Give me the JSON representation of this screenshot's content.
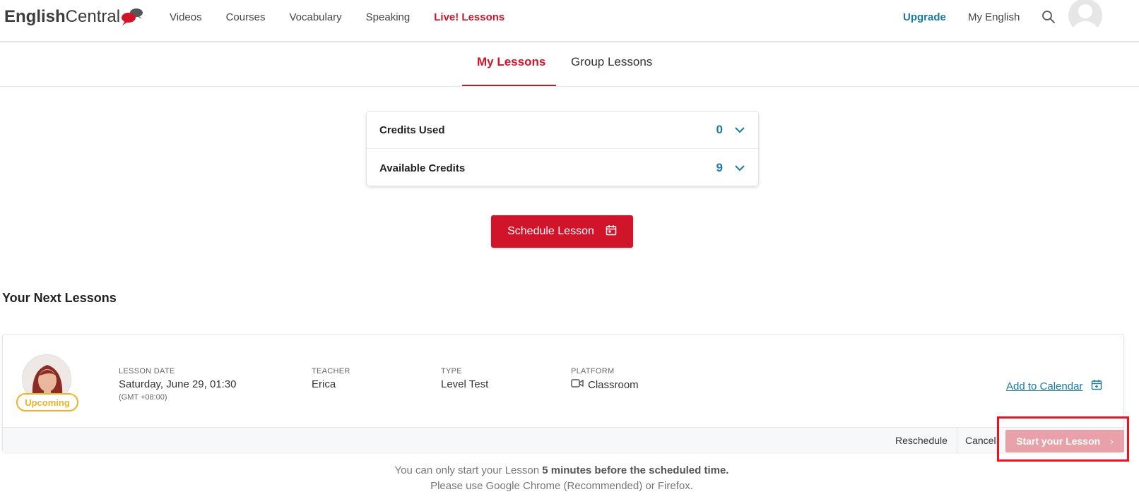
{
  "brand": {
    "english": "English",
    "central": "Central",
    "bubble_colors": [
      "#d0142a",
      "#555555"
    ]
  },
  "nav": {
    "items": [
      {
        "label": "Videos",
        "active": false
      },
      {
        "label": "Courses",
        "active": false
      },
      {
        "label": "Vocabulary",
        "active": false
      },
      {
        "label": "Speaking",
        "active": false
      },
      {
        "label": "Live! Lessons",
        "active": true
      }
    ],
    "upgrade": "Upgrade",
    "my_english": "My English",
    "search_icon": "search-icon",
    "avatar_icon": "user-avatar"
  },
  "tabs": [
    {
      "label": "My Lessons",
      "active": true
    },
    {
      "label": "Group Lessons",
      "active": false
    }
  ],
  "credits": [
    {
      "label": "Credits Used",
      "value": "0"
    },
    {
      "label": "Available Credits",
      "value": "9"
    }
  ],
  "schedule_button": {
    "label": "Schedule Lesson",
    "icon": "calendar-icon"
  },
  "next_lessons": {
    "title": "Your Next Lessons",
    "lesson": {
      "status": "Upcoming",
      "date_label": "LESSON DATE",
      "date": "Saturday, June 29, 01:30",
      "timezone": "(GMT +08:00)",
      "teacher_label": "TEACHER",
      "teacher": "Erica",
      "type_label": "TYPE",
      "type": "Level Test",
      "platform_label": "PLATFORM",
      "platform": "Classroom",
      "add_to_calendar": "Add to Calendar",
      "reschedule": "Reschedule",
      "cancel": "Cancel",
      "start": "Start your Lesson"
    }
  },
  "note": {
    "line1_prefix": "You can only start your Lesson ",
    "line1_bold": "5 minutes before the scheduled time.",
    "line2": "Please use Google Chrome (Recommended) or Firefox."
  },
  "colors": {
    "accent": "#d0142a",
    "link": "#1a7aa0",
    "badge": "#f0b323",
    "start_disabled": "#e9a1a9",
    "highlight": "#e8141e"
  }
}
